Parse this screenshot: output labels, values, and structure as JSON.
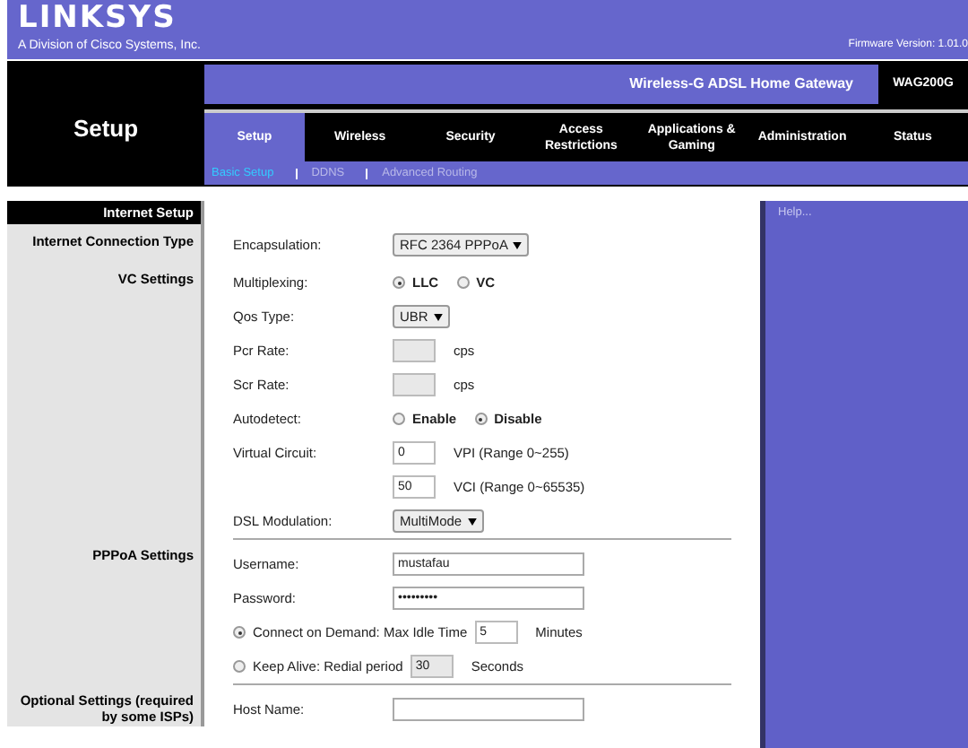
{
  "header": {
    "logo": "LINKSYS",
    "tagline": "A Division of Cisco Systems, Inc.",
    "firmware": "Firmware Version: 1.01.0"
  },
  "page_title": "Setup",
  "product": {
    "name": "Wireless-G ADSL Home Gateway",
    "model": "WAG200G"
  },
  "tabs": [
    {
      "label": "Setup",
      "selected": true
    },
    {
      "label": "Wireless",
      "selected": false
    },
    {
      "label": "Security",
      "selected": false
    },
    {
      "label": "Access Restrictions",
      "selected": false
    },
    {
      "label": "Applications & Gaming",
      "selected": false
    },
    {
      "label": "Administration",
      "selected": false
    },
    {
      "label": "Status",
      "selected": false
    }
  ],
  "subtabs": [
    {
      "label": "Basic Setup",
      "selected": true
    },
    {
      "label": "DDNS",
      "selected": false
    },
    {
      "label": "Advanced Routing",
      "selected": false
    }
  ],
  "section_header": "Internet Setup",
  "help": "Help...",
  "sections": [
    {
      "label": "Internet Connection Type",
      "rows": [
        {
          "kind": "select",
          "label": "Encapsulation:",
          "value": "RFC 2364 PPPoA"
        }
      ]
    },
    {
      "label": "VC Settings",
      "rows": [
        {
          "kind": "radio",
          "label": "Multiplexing:",
          "options": [
            {
              "label": "LLC",
              "selected": true
            },
            {
              "label": "VC",
              "selected": false
            }
          ]
        },
        {
          "kind": "select",
          "label": "Qos Type:",
          "value": "UBR"
        },
        {
          "kind": "input",
          "label": "Pcr Rate:",
          "value": "",
          "disabled": true,
          "suffix": "cps"
        },
        {
          "kind": "input",
          "label": "Scr Rate:",
          "value": "",
          "disabled": true,
          "suffix": "cps"
        },
        {
          "kind": "radio",
          "label": "Autodetect:",
          "options": [
            {
              "label": "Enable",
              "selected": false
            },
            {
              "label": "Disable",
              "selected": true
            }
          ]
        },
        {
          "kind": "input",
          "label": "Virtual Circuit:",
          "value": "0",
          "disabled": false,
          "suffix": "VPI (Range 0~255)"
        },
        {
          "kind": "input",
          "value": "50",
          "disabled": false,
          "suffix": "VCI (Range 0~65535)"
        },
        {
          "kind": "select",
          "label": "DSL Modulation:",
          "value": "MultiMode"
        }
      ]
    },
    {
      "label": "PPPoA Settings",
      "rows": [
        {
          "kind": "text",
          "label": "Username:",
          "value": "mustafau"
        },
        {
          "kind": "text",
          "label": "Password:",
          "value": "•••••••••"
        },
        {
          "kind": "option",
          "selected": true,
          "label": "Connect on Demand: Max Idle Time",
          "value": "5",
          "disabled": false,
          "suffix": "Minutes"
        },
        {
          "kind": "option",
          "selected": false,
          "label": "Keep Alive: Redial period",
          "value": "30",
          "disabled": true,
          "suffix": "Seconds"
        }
      ]
    },
    {
      "label": "Optional Settings (required by some ISPs)",
      "rows": [
        {
          "kind": "text",
          "label": "Host Name:",
          "value": ""
        }
      ]
    }
  ]
}
